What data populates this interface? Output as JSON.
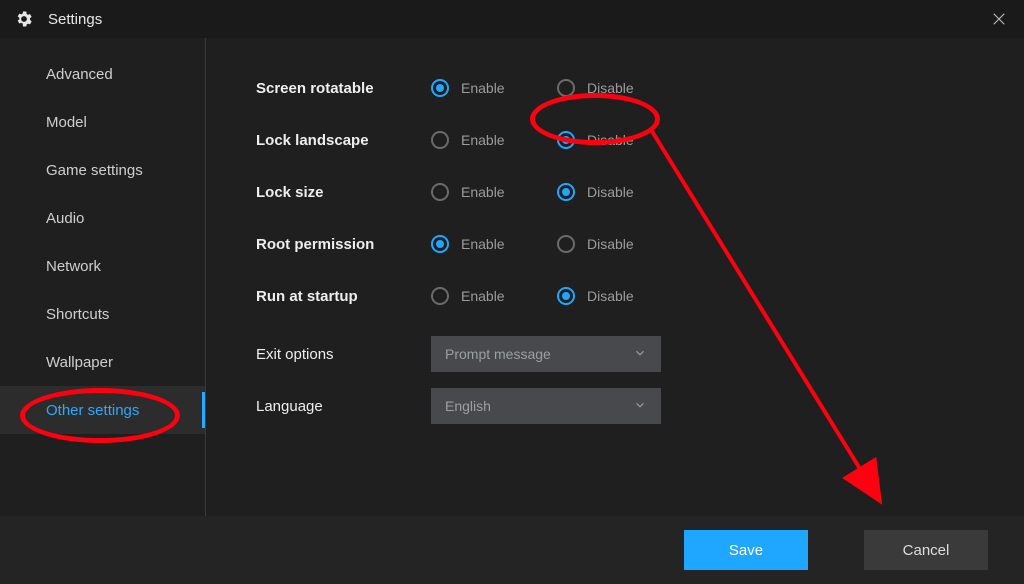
{
  "window": {
    "title": "Settings"
  },
  "sidebar": {
    "items": [
      {
        "label": "Advanced"
      },
      {
        "label": "Model"
      },
      {
        "label": "Game settings"
      },
      {
        "label": "Audio"
      },
      {
        "label": "Network"
      },
      {
        "label": "Shortcuts"
      },
      {
        "label": "Wallpaper"
      },
      {
        "label": "Other settings"
      }
    ],
    "active_index": 7
  },
  "settings": {
    "rows": [
      {
        "label": "Screen rotatable",
        "options": [
          "Enable",
          "Disable"
        ],
        "selected": 0
      },
      {
        "label": "Lock landscape",
        "options": [
          "Enable",
          "Disable"
        ],
        "selected": 1
      },
      {
        "label": "Lock size",
        "options": [
          "Enable",
          "Disable"
        ],
        "selected": 1
      },
      {
        "label": "Root permission",
        "options": [
          "Enable",
          "Disable"
        ],
        "selected": 0
      },
      {
        "label": "Run at startup",
        "options": [
          "Enable",
          "Disable"
        ],
        "selected": 1
      }
    ],
    "exit_options": {
      "label": "Exit options",
      "value": "Prompt message"
    },
    "language": {
      "label": "Language",
      "value": "English"
    }
  },
  "footer": {
    "save": "Save",
    "cancel": "Cancel"
  },
  "colors": {
    "accent": "#1fa7ff",
    "annotation": "#ff0010"
  }
}
